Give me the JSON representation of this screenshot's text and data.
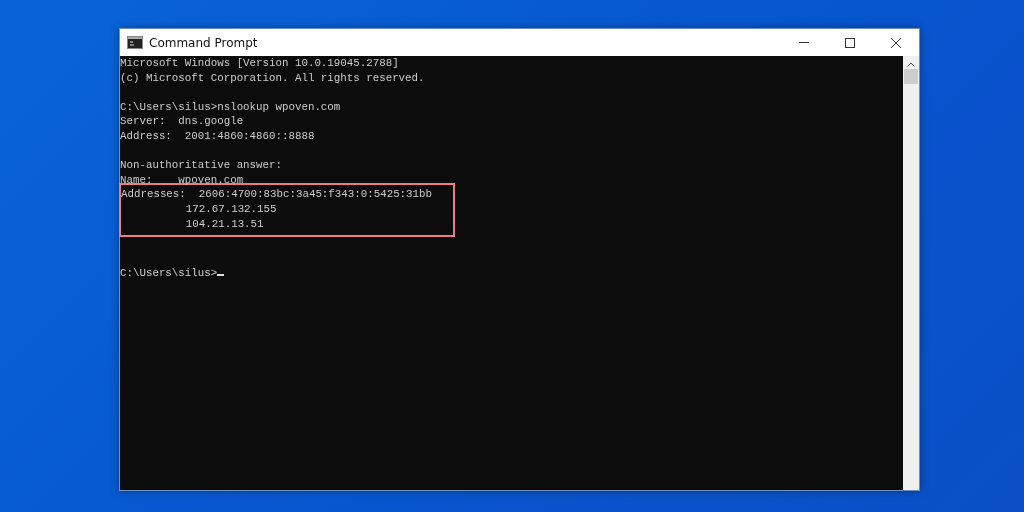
{
  "window": {
    "title": "Command Prompt"
  },
  "console": {
    "blocks": [
      {
        "kind": "output",
        "lines": [
          "Microsoft Windows [Version 10.0.19045.2788]",
          "(c) Microsoft Corporation. All rights reserved."
        ]
      },
      {
        "kind": "output",
        "lines": [
          "C:\\Users\\silus>nslookup wpoven.com",
          "Server:  dns.google",
          "Address:  2001:4860:4860::8888"
        ]
      },
      {
        "kind": "output",
        "lines": [
          "Non-authoritative answer:",
          "Name:    wpoven.com"
        ]
      },
      {
        "kind": "highlight",
        "lines": [
          "Addresses:  2606:4700:83bc:3a45:f343:0:5425:31bb",
          "          172.67.132.155",
          "          104.21.13.51"
        ]
      },
      {
        "kind": "prompt",
        "lines": [
          "C:\\Users\\silus>"
        ]
      }
    ]
  }
}
